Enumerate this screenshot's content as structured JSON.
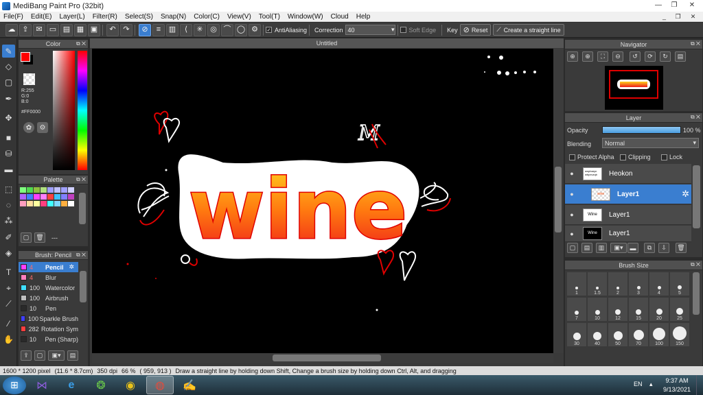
{
  "window": {
    "title": "MediBang Paint Pro (32bit)"
  },
  "menu": [
    "File(F)",
    "Edit(E)",
    "Layer(L)",
    "Filter(R)",
    "Select(S)",
    "Snap(N)",
    "Color(C)",
    "View(V)",
    "Tool(T)",
    "Window(W)",
    "Cloud",
    "Help"
  ],
  "toolbar": {
    "antialias_label": "AntiAliasing",
    "correction_label": "Correction",
    "correction_value": "40",
    "soft_edge_label": "Soft Edge",
    "key_label": "Key",
    "reset_label": "Reset",
    "straight_line_label": "Create a straight line"
  },
  "color_panel": {
    "title": "Color",
    "r": "R:255",
    "g": "G:0",
    "b": "B:0",
    "hex": "#FF0000",
    "primary": "#ff0000"
  },
  "palette_panel": {
    "title": "Palette",
    "more": "---",
    "colors": [
      "#7fff7f",
      "#4fd94f",
      "#8fbf3f",
      "#b0e080",
      "#9f9fff",
      "#c0c0ff",
      "#a0a0ff",
      "#d0d0ff",
      "#b060ff",
      "#3f7fff",
      "#ff3fff",
      "#ff7fff",
      "#ff3f3f",
      "#3fbfff",
      "#8080ff",
      "#c040c0",
      "#ff9fbf",
      "#ffdf9f",
      "#ffff9f",
      "#ff3f7f",
      "#3fffff",
      "#7fd9ff",
      "#ffaf3f",
      "#ffffff"
    ]
  },
  "brush_panel": {
    "title": "Brush: Pencil",
    "items": [
      {
        "size": "4",
        "name": "Pencil",
        "color": "#ff3fff"
      },
      {
        "size": "4",
        "name": "Blur",
        "color": "#ff7fbf"
      },
      {
        "size": "100",
        "name": "Watercolor",
        "color": "#3fdfff"
      },
      {
        "size": "100",
        "name": "Airbrush",
        "color": "#bfbfbf"
      },
      {
        "size": "10",
        "name": "Pen",
        "color": "#2a2a2a"
      },
      {
        "size": "100",
        "name": "Sparkle Brush",
        "color": "#3f3fff"
      },
      {
        "size": "282",
        "name": "Rotation Sym",
        "color": "#ff3f3f"
      },
      {
        "size": "10",
        "name": "Pen (Sharp)",
        "color": "#2a2a2a"
      }
    ]
  },
  "document": {
    "tab": "Untitled",
    "word": "wine",
    "scribble": "M"
  },
  "navigator": {
    "title": "Navigator"
  },
  "layer_panel": {
    "title": "Layer",
    "opacity_label": "Opacity",
    "opacity_value": "100 %",
    "opacity_fraction": 1.0,
    "blending_label": "Blending",
    "blending_value": "Normal",
    "protect_alpha_label": "Protect Alpha",
    "clipping_label": "Clipping",
    "lock_label": "Lock",
    "layers": [
      {
        "name": "Heokon",
        "thumb_text": "wnpbaryn\nwbpxvzqb"
      },
      {
        "name": "Layer1",
        "thumb_text": "wine"
      },
      {
        "name": "Layer1",
        "thumb_text": "Wine"
      },
      {
        "name": "Layer1",
        "thumb_text": "Wine"
      }
    ]
  },
  "brush_size_panel": {
    "title": "Brush Size",
    "sizes": [
      "1",
      "1.5",
      "2",
      "3",
      "4",
      "5",
      "7",
      "10",
      "12",
      "15",
      "20",
      "25",
      "30",
      "40",
      "50",
      "70",
      "100",
      "150"
    ]
  },
  "status": {
    "pixels": "1600 * 1200 pixel",
    "cm": "(11.6 * 8.7cm)",
    "dpi": "350 dpi",
    "zoom": "66 %",
    "coords": "( 959, 913 )",
    "hint": "Draw a straight line by holding down Shift, Change a brush size by holding down Ctrl, Alt, and dragging"
  },
  "taskbar": {
    "lang": "EN",
    "time": "9:37 AM",
    "date": "9/13/2021"
  }
}
